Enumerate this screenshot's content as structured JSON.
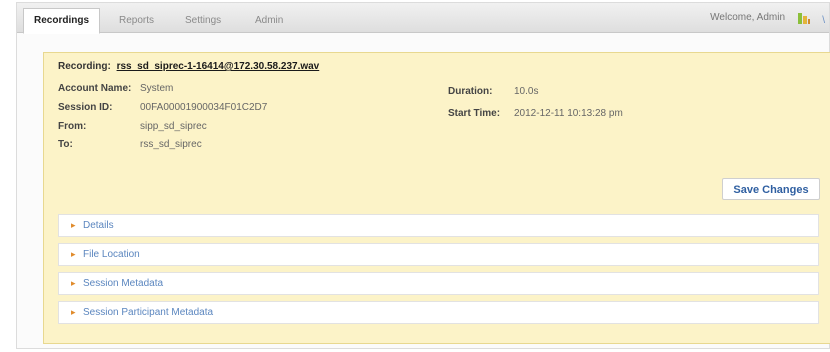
{
  "tabs": [
    {
      "label": "Recordings"
    },
    {
      "label": "Reports"
    },
    {
      "label": "Settings"
    },
    {
      "label": "Admin"
    }
  ],
  "header": {
    "welcome": "Welcome, Admin",
    "extra": "\\"
  },
  "recording": {
    "label": "Recording:",
    "file": "rss_sd_siprec-1-16414@172.30.58.237.wav"
  },
  "details": {
    "account_name_label": "Account Name:",
    "account_name": "System",
    "session_id_label": "Session ID:",
    "session_id": "00FA00001900034F01C2D7",
    "from_label": "From:",
    "from": "sipp_sd_siprec",
    "to_label": "To:",
    "to": "rss_sd_siprec",
    "duration_label": "Duration:",
    "duration": "10.0s",
    "start_time_label": "Start Time:",
    "start_time": "2012-12-11 10:13:28 pm"
  },
  "actions": {
    "save_label": "Save Changes"
  },
  "sections": [
    {
      "arrow": "▸",
      "title": "Details"
    },
    {
      "arrow": "▸",
      "title": "File Location"
    },
    {
      "arrow": "▸",
      "title": "Session Metadata"
    },
    {
      "arrow": "▸",
      "title": "Session Participant Metadata"
    }
  ]
}
